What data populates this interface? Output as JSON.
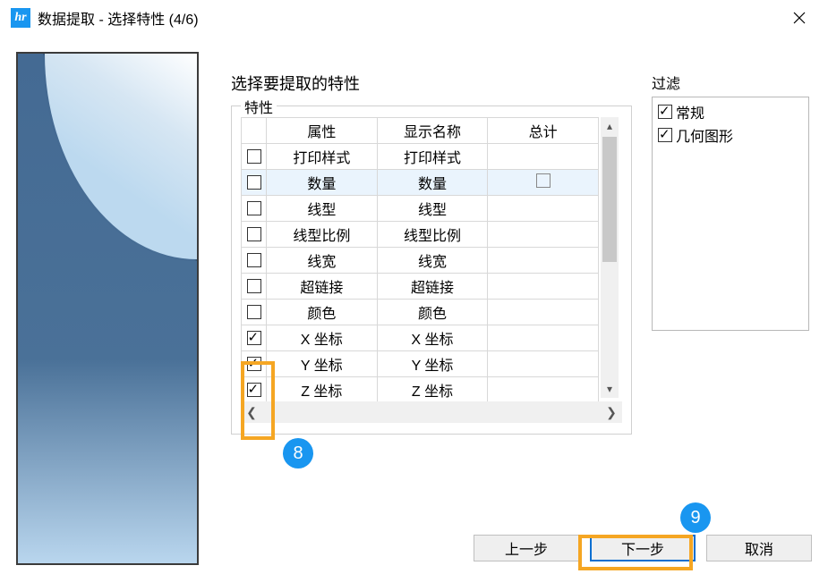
{
  "title": "数据提取 - 选择特性 (4/6)",
  "prompt": "选择要提取的特性",
  "group_label": "特性",
  "columns": {
    "c1": "属性",
    "c2": "显示名称",
    "c3": "总计"
  },
  "rows": [
    {
      "checked": false,
      "attr": "打印样式",
      "disp": "打印样式",
      "hl": false,
      "tot": false
    },
    {
      "checked": false,
      "attr": "数量",
      "disp": "数量",
      "hl": true,
      "tot": true
    },
    {
      "checked": false,
      "attr": "线型",
      "disp": "线型",
      "hl": false,
      "tot": false
    },
    {
      "checked": false,
      "attr": "线型比例",
      "disp": "线型比例",
      "hl": false,
      "tot": false
    },
    {
      "checked": false,
      "attr": "线宽",
      "disp": "线宽",
      "hl": false,
      "tot": false
    },
    {
      "checked": false,
      "attr": "超链接",
      "disp": "超链接",
      "hl": false,
      "tot": false
    },
    {
      "checked": false,
      "attr": "颜色",
      "disp": "颜色",
      "hl": false,
      "tot": false
    },
    {
      "checked": true,
      "attr": "X 坐标",
      "disp": "X 坐标",
      "hl": false,
      "tot": false
    },
    {
      "checked": true,
      "attr": "Y 坐标",
      "disp": "Y 坐标",
      "hl": false,
      "tot": false
    },
    {
      "checked": true,
      "attr": "Z 坐标",
      "disp": "Z 坐标",
      "hl": false,
      "tot": false
    }
  ],
  "filter_label": "过滤",
  "filter_items": [
    {
      "checked": true,
      "label": "常规"
    },
    {
      "checked": true,
      "label": "几何图形"
    }
  ],
  "buttons": {
    "prev": "上一步",
    "next": "下一步",
    "cancel": "取消"
  },
  "markers": {
    "m8": "8",
    "m9": "9"
  }
}
